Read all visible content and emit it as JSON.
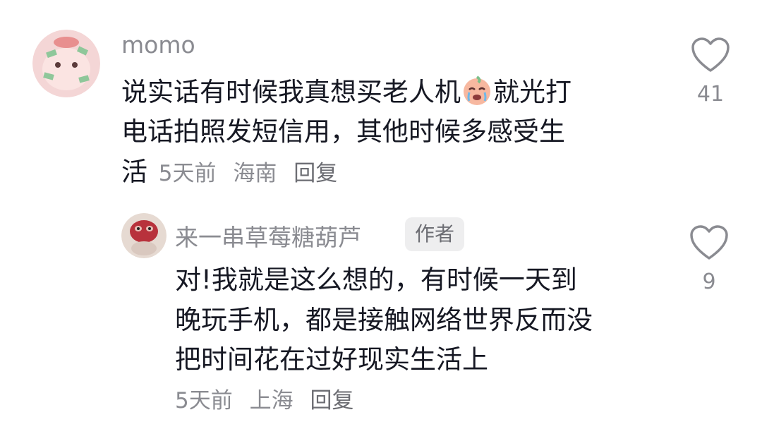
{
  "comments": [
    {
      "username": "momo",
      "lines": [
        "说实话有时候我真想买老人机",
        "就光打",
        "电话拍照发短信用，其他时候多感受生",
        "活"
      ],
      "meta": {
        "time": "5天前",
        "location": "海南",
        "reply": "回复"
      },
      "like_count": "41",
      "emoji": "crying-face"
    },
    {
      "username": "来一串草莓糖葫芦",
      "badge": "作者",
      "lines": [
        "对!我就是这么想的，有时候一天到",
        "晚玩手机，都是接触网络世界反而没",
        "把时间花在过好现实生活上"
      ],
      "meta": {
        "time": "5天前",
        "location": "上海",
        "reply": "回复"
      },
      "like_count": "9"
    }
  ],
  "colors": {
    "text": "#161823",
    "meta": "#8a8b91",
    "badge_bg": "#eeeeef",
    "icon": "#8a8b91"
  }
}
